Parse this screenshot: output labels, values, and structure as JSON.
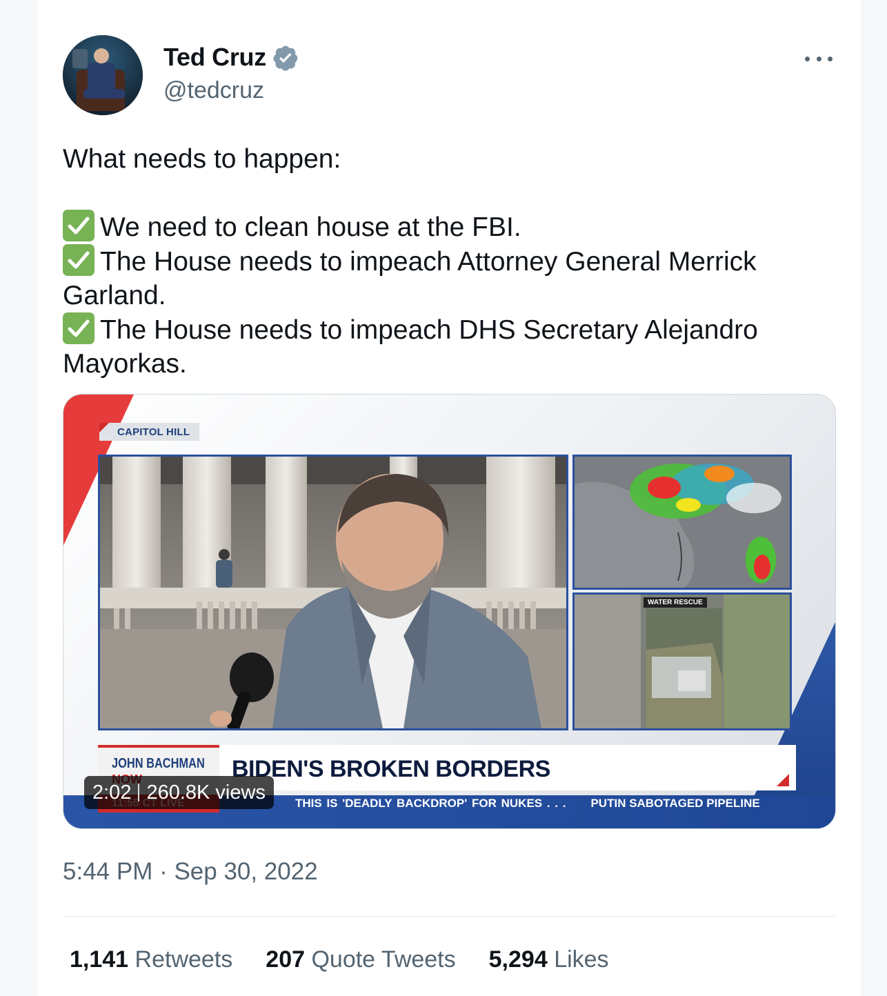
{
  "author": {
    "name": "Ted Cruz",
    "handle": "@tedcruz",
    "verified_color": "#829aab"
  },
  "tweet": {
    "intro": "What needs to happen:",
    "items": [
      "We need to clean house at the FBI.",
      "The House needs to impeach Attorney General Merrick Garland.",
      "The House needs to impeach DHS Secretary Alejandro Mayorkas."
    ],
    "item_icon": "check-mark-button-icon",
    "timestamp": "5:44 PM · Sep 30, 2022"
  },
  "media": {
    "type": "video",
    "duration": "2:02",
    "views": "260.8K views",
    "tv": {
      "location_tag": "CAPITOL HILL",
      "anchor": "JOHN BACHMAN",
      "now": "NOW",
      "headline": "BIDEN'S BROKEN BORDERS",
      "water_label": "WATER RESCUE",
      "ticker_time": "11:55 CT LIVE",
      "ticker_items": [
        "THIS IS 'DEADLY BACKDROP' FOR NUKES . . .",
        "PUTIN SABOTAGED PIPELINE"
      ],
      "colors": {
        "red": "#d32b2b",
        "blue": "#2a4f9e",
        "navy": "#1f3f7a"
      }
    }
  },
  "stats": [
    {
      "count": "1,141",
      "label": "Retweets"
    },
    {
      "count": "207",
      "label": "Quote Tweets"
    },
    {
      "count": "5,294",
      "label": "Likes"
    }
  ]
}
